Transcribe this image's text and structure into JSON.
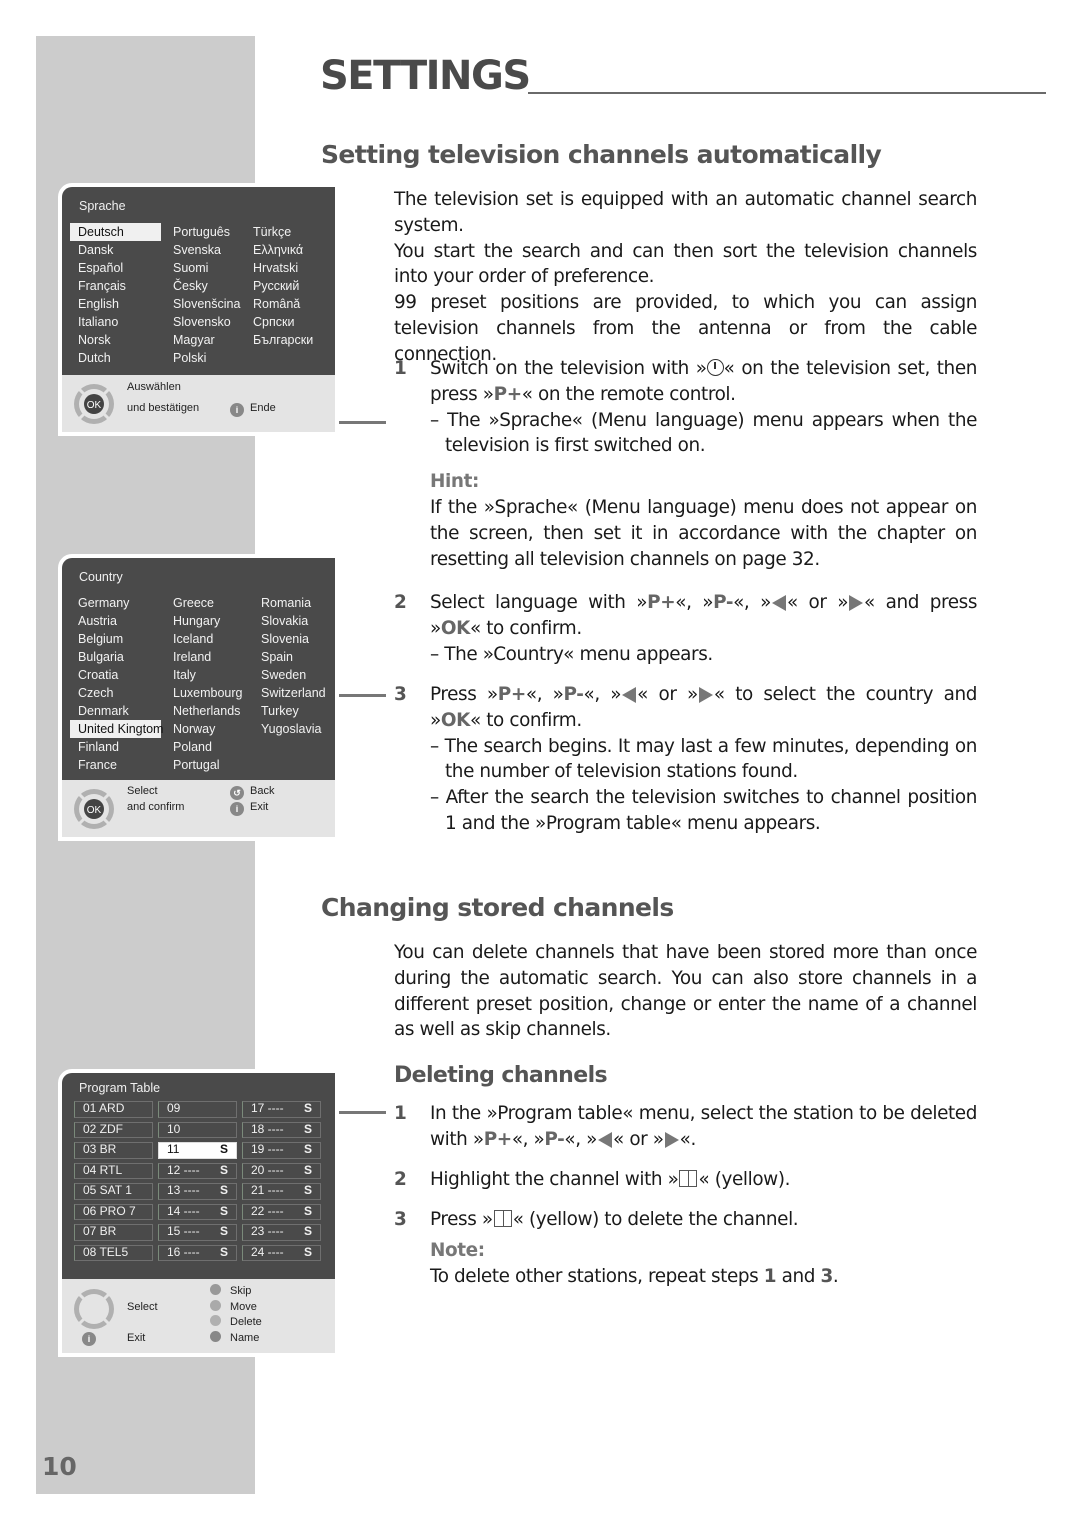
{
  "page": {
    "title": "SETTINGS",
    "page_number": "10"
  },
  "section_auto": {
    "heading": "Setting television channels automatically",
    "intro": [
      "The television set is equipped with an automatic channel search system.",
      "You start the search and can then sort the television channels into your order of preference.",
      "99 preset positions are provided, to which you can assign television channels from the antenna or from the cable connection."
    ],
    "step1": {
      "num": "1",
      "text_a": "Switch on the television with »",
      "text_b": "« on the television set, then press »",
      "key_p_plus": "P+",
      "text_c": "« on the remote control.",
      "sub": "– The »Sprache« (Menu language) menu appears when the television is first switched on.",
      "hint_label": "Hint:",
      "hint_text": "If the »Sprache« (Menu language) menu does not appear on the screen, then set it in accordance with the chapter on resetting all television channels on page 32."
    },
    "step2": {
      "num": "2",
      "text_a": "Select language with »",
      "key_p_plus": "P+",
      "sep1": "«, »",
      "key_p_minus": "P-",
      "sep2": "«, »",
      "sep3": "« or »",
      "text_b": "« and press »",
      "key_ok": "OK",
      "text_c": "« to confirm.",
      "sub": "– The »Country« menu appears."
    },
    "step3": {
      "num": "3",
      "text_a": "Press »",
      "key_p_plus": "P+",
      "sep1": "«, »",
      "key_p_minus": "P-",
      "sep2": "«, »",
      "sep3": "« or »",
      "text_b": "« to select the country and »",
      "key_ok": "OK",
      "text_c": "« to confirm.",
      "sub1": "– The search begins. It may last a few minutes, depending on the number of television stations found.",
      "sub2": "– After the search the television switches to channel position 1 and the »Program table« menu appears."
    }
  },
  "section_change": {
    "heading": "Changing stored channels",
    "intro": "You can delete channels that have been stored more than once during the automatic search. You can also store channels in a different preset position, change or enter the name of a channel as well as skip channels.",
    "sub_heading": "Deleting channels",
    "step1": {
      "num": "1",
      "text_a": "In the »Program table« menu, select the station to be deleted with »",
      "key_p_plus": "P+",
      "sep1": "«, »",
      "key_p_minus": "P-",
      "sep2": "«, »",
      "sep3": "« or »",
      "text_b": "«."
    },
    "step2": {
      "num": "2",
      "text_a": "Highlight the channel with »",
      "text_b": "« (yellow)."
    },
    "step3": {
      "num": "3",
      "text_a": "Press »",
      "text_b": "« (yellow) to delete the channel.",
      "note_label": "Note:",
      "note_a": "To delete other stations, repeat steps ",
      "ref1": "1",
      "note_b": " and ",
      "ref2": "3",
      "note_c": "."
    }
  },
  "menu_sprache": {
    "title": "Sprache",
    "columns": [
      [
        "Deutsch",
        "Dansk",
        "Español",
        "Français",
        "English",
        "Italiano",
        "Norsk",
        "Dutch"
      ],
      [
        "Português",
        "Svenska",
        "Suomi",
        "Česky",
        "Slovenšcina",
        "Slovensko",
        "Magyar",
        "Polski"
      ],
      [
        "Türkçe",
        "Ελληνικά",
        "Hrvatski",
        "Русский",
        "Română",
        "Српски",
        "Български",
        ""
      ]
    ],
    "selected": "Deutsch",
    "footer": {
      "select": "Auswählen",
      "confirm": "und bestätigen",
      "exit": "Ende",
      "ok_label": "OK",
      "info_label": "i"
    }
  },
  "menu_country": {
    "title": "Country",
    "columns": [
      [
        "Germany",
        "Austria",
        "Belgium",
        "Bulgaria",
        "Croatia",
        "Czech",
        "Denmark",
        "United Kingtom",
        "Finland",
        "France"
      ],
      [
        "Greece",
        "Hungary",
        "Iceland",
        "Ireland",
        "Italy",
        "Luxembourg",
        "Netherlands",
        "Norway",
        "Poland",
        "Portugal"
      ],
      [
        "Romania",
        "Slovakia",
        "Slovenia",
        "Spain",
        "Sweden",
        "Switzerland",
        "Turkey",
        "Yugoslavia",
        "",
        ""
      ]
    ],
    "selected": "United Kingtom",
    "footer": {
      "select": "Select",
      "confirm": "and confirm",
      "back": "Back",
      "exit": "Exit",
      "ok_label": "OK",
      "info_label": "i"
    }
  },
  "menu_program": {
    "title": "Program Table",
    "columns": [
      [
        {
          "label": "01 ARD",
          "flag": ""
        },
        {
          "label": "02 ZDF",
          "flag": ""
        },
        {
          "label": "03 BR",
          "flag": ""
        },
        {
          "label": "04 RTL",
          "flag": ""
        },
        {
          "label": "05 SAT 1",
          "flag": ""
        },
        {
          "label": "06 PRO 7",
          "flag": ""
        },
        {
          "label": "07 BR",
          "flag": ""
        },
        {
          "label": "08 TEL5",
          "flag": ""
        }
      ],
      [
        {
          "label": "09",
          "flag": ""
        },
        {
          "label": "10",
          "flag": ""
        },
        {
          "label": "11",
          "flag": "S"
        },
        {
          "label": "12 ----",
          "flag": "S"
        },
        {
          "label": "13 ----",
          "flag": "S"
        },
        {
          "label": "14 ----",
          "flag": "S"
        },
        {
          "label": "15 ----",
          "flag": "S"
        },
        {
          "label": "16 ----",
          "flag": "S"
        }
      ],
      [
        {
          "label": "17 ----",
          "flag": "S"
        },
        {
          "label": "18 ----",
          "flag": "S"
        },
        {
          "label": "19 ----",
          "flag": "S"
        },
        {
          "label": "20 ----",
          "flag": "S"
        },
        {
          "label": "21 ----",
          "flag": "S"
        },
        {
          "label": "22 ----",
          "flag": "S"
        },
        {
          "label": "23 ----",
          "flag": "S"
        },
        {
          "label": "24 ----",
          "flag": "S"
        }
      ]
    ],
    "selected": "11",
    "footer": {
      "select": "Select",
      "exit": "Exit",
      "skip": "Skip",
      "move": "Move",
      "delete": "Delete",
      "name": "Name",
      "info_label": "i"
    }
  },
  "colors": {
    "sidebar_band": "#cccccc",
    "menu_background": "#4a4a4a",
    "menu_footer": "#e4e4e4",
    "heading_text": "#555555",
    "key_text": "#666666"
  }
}
